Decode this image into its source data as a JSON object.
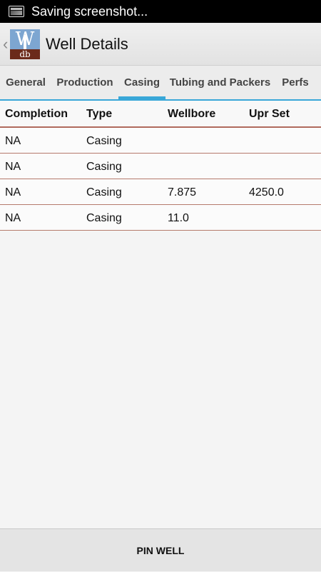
{
  "status_bar": {
    "text": "Saving screenshot...",
    "icon": "screenshot-icon"
  },
  "action_bar": {
    "title": "Well Details",
    "logo_top": "W",
    "logo_bottom": "db"
  },
  "tabs": [
    {
      "label": "General",
      "active": false
    },
    {
      "label": "Production",
      "active": false
    },
    {
      "label": "Casing",
      "active": true
    },
    {
      "label": "Tubing and Packers",
      "active": false
    },
    {
      "label": "Perfs",
      "active": false
    }
  ],
  "table": {
    "headers": [
      "Completion",
      "Type",
      "Wellbore",
      "Upr Set"
    ],
    "rows": [
      [
        "NA",
        "Casing",
        "",
        ""
      ],
      [
        "NA",
        "Casing",
        "",
        ""
      ],
      [
        "NA",
        "Casing",
        "7.875",
        "4250.0"
      ],
      [
        "NA",
        "Casing",
        "11.0",
        ""
      ]
    ]
  },
  "bottom_bar": {
    "pin_label": "PIN WELL"
  },
  "colors": {
    "accent": "#39a7d8",
    "row_divider": "#b57a6c"
  }
}
